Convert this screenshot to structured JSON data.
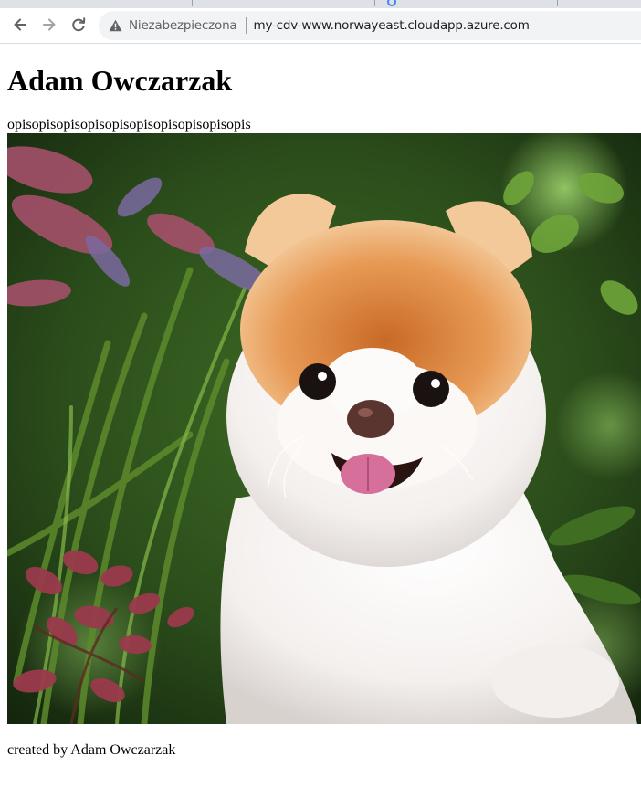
{
  "browser": {
    "security_label": "Niezabezpieczona",
    "url": "my-cdv-www.norwayeast.cloudapp.azure.com",
    "back_icon": "arrow-left-icon",
    "forward_icon": "arrow-right-icon",
    "reload_icon": "reload-icon",
    "security_icon": "warning-triangle-icon"
  },
  "page": {
    "title": "Adam Owczarzak",
    "description": "opisopisopisopisopisopisopisopisopisopis",
    "image_subject": "pomeranian-puppy",
    "footer": "created by Adam Owczarzak"
  },
  "colors": {
    "toolbar_bg": "#ffffff",
    "omnibox_bg": "#f1f3f4",
    "tabstrip_bg": "#dee1e6",
    "text": "#000000"
  }
}
